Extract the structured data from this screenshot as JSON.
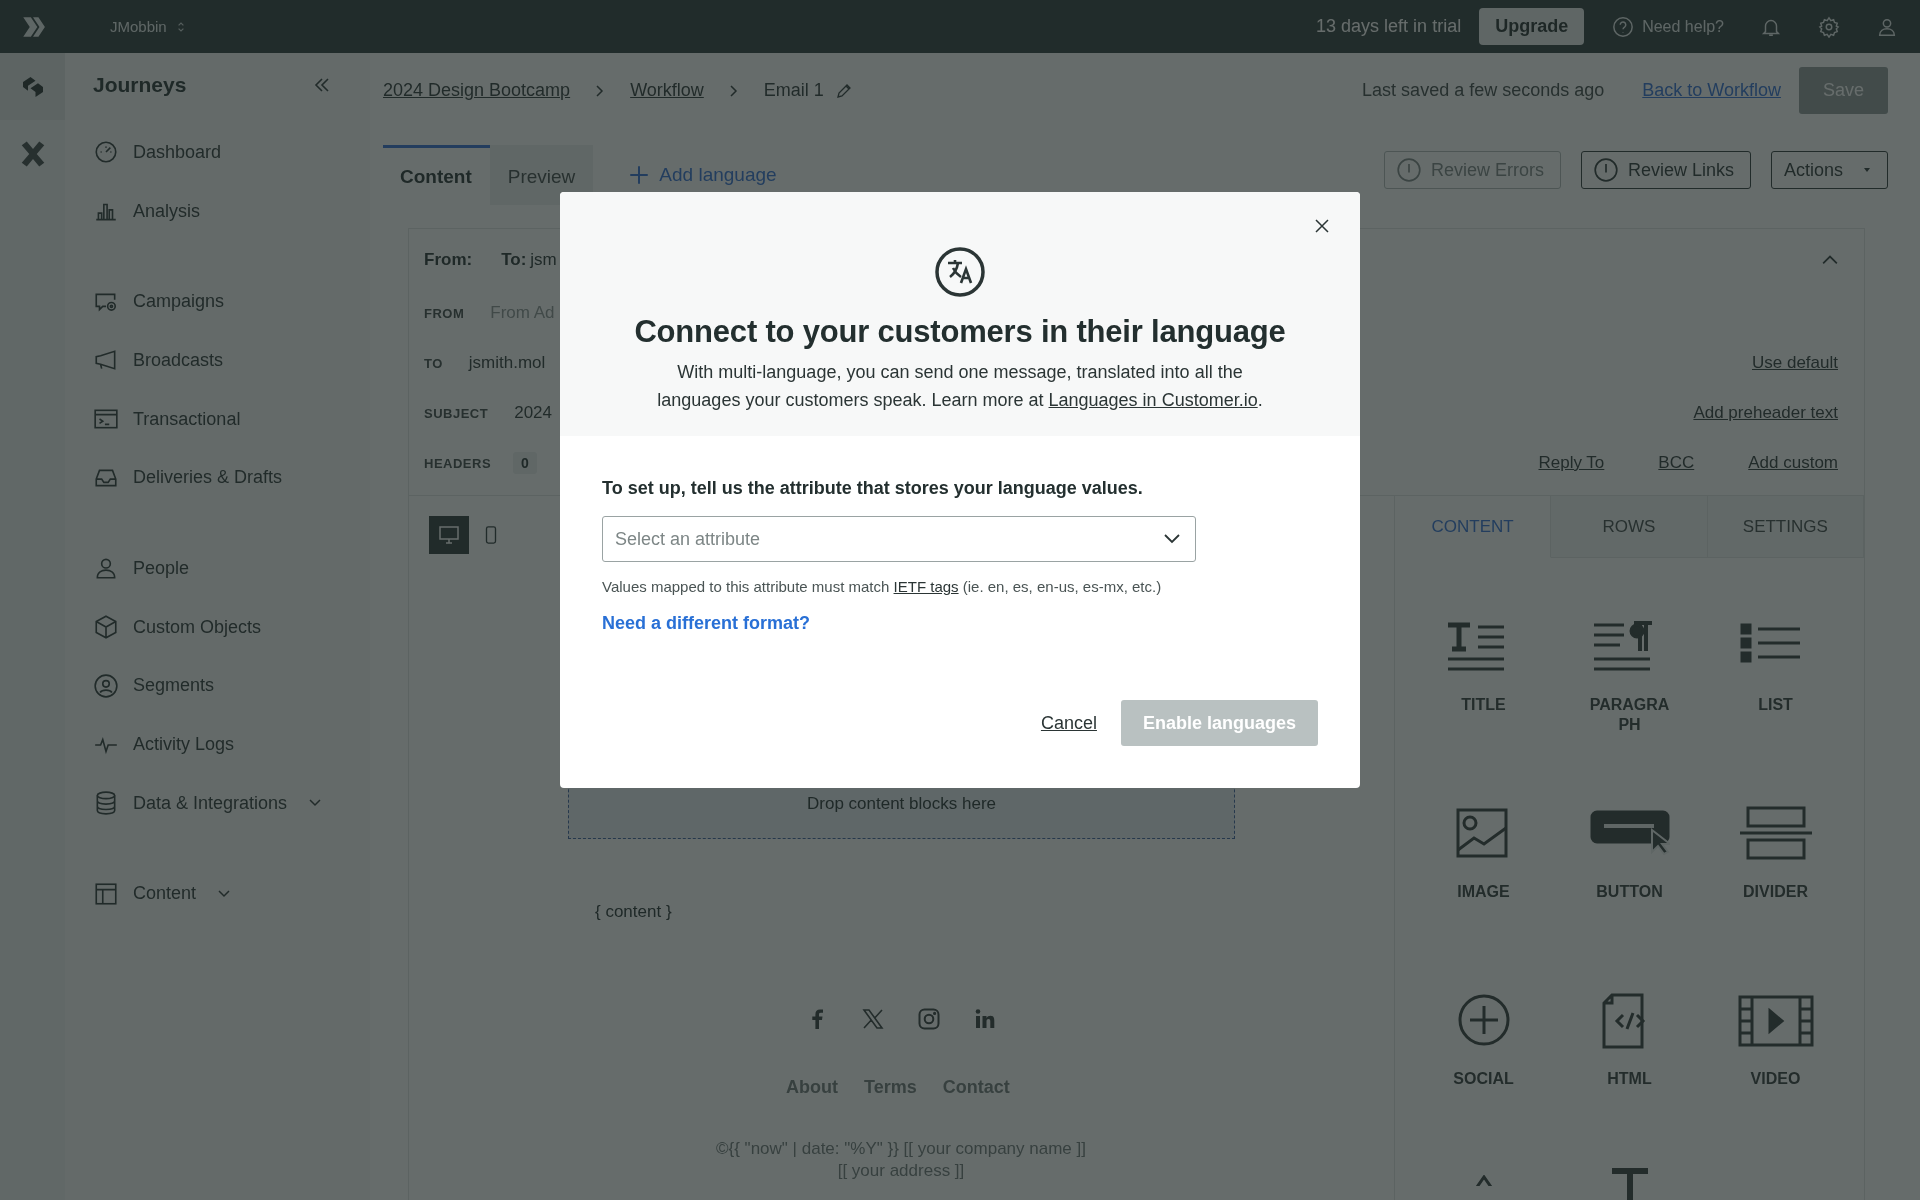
{
  "top_bar": {
    "workspace": "JMobbin",
    "trial": "13 days left in trial",
    "upgrade": "Upgrade",
    "help": "Need help?"
  },
  "sidebar": {
    "title": "Journeys",
    "groups": [
      [
        {
          "label": "Dashboard",
          "kind": "link"
        },
        {
          "label": "Analysis",
          "kind": "link"
        }
      ],
      [
        {
          "label": "Campaigns",
          "kind": "link"
        },
        {
          "label": "Broadcasts",
          "kind": "link"
        },
        {
          "label": "Transactional",
          "kind": "link"
        },
        {
          "label": "Deliveries & Drafts",
          "kind": "link"
        }
      ],
      [
        {
          "label": "People",
          "kind": "link"
        },
        {
          "label": "Custom Objects",
          "kind": "link"
        },
        {
          "label": "Segments",
          "kind": "link"
        },
        {
          "label": "Activity Logs",
          "kind": "link"
        },
        {
          "label": "Data & Integrations",
          "kind": "group"
        }
      ],
      [
        {
          "label": "Content",
          "kind": "group"
        }
      ]
    ]
  },
  "breadcrumbs": [
    {
      "label": "2024 Design Bootcamp",
      "kind": "link"
    },
    {
      "label": "Workflow",
      "kind": "link"
    },
    {
      "label": "Email 1",
      "kind": "current"
    }
  ],
  "saved": "Last saved a few seconds ago",
  "back_link": "Back to Workflow",
  "save": {
    "label": "Save",
    "disabled": true
  },
  "tabs": [
    {
      "label": "Content",
      "selected": true
    },
    {
      "label": "Preview",
      "selected": false
    }
  ],
  "add_language": "Add language",
  "actions": [
    {
      "label": "Review Errors",
      "kind": "review",
      "disabled": true
    },
    {
      "label": "Review Links",
      "kind": "review",
      "disabled": false
    },
    {
      "label": "Actions",
      "kind": "menu",
      "disabled": false
    }
  ],
  "email_header": {
    "from_label": "From:",
    "to_label": "To:",
    "to_value": "jsm",
    "fields": [
      {
        "label": "FROM",
        "placeholder": "From Ad"
      },
      {
        "label": "TO",
        "value": "jsmith.mol",
        "link": "Use default"
      },
      {
        "label": "SUBJECT",
        "value": "2024",
        "link": "Add preheader text"
      },
      {
        "label": "HEADERS",
        "count": "0"
      }
    ],
    "links": [
      "Reply To",
      "BCC",
      "Add custom"
    ]
  },
  "view_toggle": [
    {
      "kind": "desktop",
      "selected": true
    },
    {
      "kind": "mobile",
      "selected": false
    }
  ],
  "canvas": {
    "drop_zone": "Drop content blocks here",
    "content": "{ content }",
    "footer_links": [
      "About",
      "Terms",
      "Contact"
    ],
    "footer_lines": [
      "©{{ \"now\" | date: \"%Y\" }} [[ your company name ]]",
      "[[ your address ]]"
    ]
  },
  "panel": {
    "tabs": [
      {
        "label": "CONTENT",
        "selected": true
      },
      {
        "label": "ROWS",
        "selected": false
      },
      {
        "label": "SETTINGS",
        "selected": false
      }
    ],
    "blocks": [
      {
        "label": "TITLE"
      },
      {
        "label": "PARAGRAPH"
      },
      {
        "label": "LIST"
      },
      {
        "label": "IMAGE"
      },
      {
        "label": "BUTTON"
      },
      {
        "label": "DIVIDER"
      },
      {
        "label": "SOCIAL"
      },
      {
        "label": "HTML"
      },
      {
        "label": "VIDEO"
      }
    ]
  },
  "modal": {
    "title": "Connect to your customers in their language",
    "intro": "With multi-language, you can send one message, translated into all the languages your customers speak. Learn more at",
    "intro_link": "Languages in Customer.io",
    "intro_end": ".",
    "field_label": "To set up, tell us the attribute that stores your language values.",
    "select": {
      "placeholder": "Select an attribute"
    },
    "hint": "Values mapped to this attribute must match",
    "hint_link": "IETF tags",
    "hint_end": "(ie. en, es, en-us, es-mx, etc.)",
    "format_link": "Need a different format?",
    "cancel": "Cancel",
    "confirm": {
      "label": "Enable languages",
      "disabled": true
    }
  }
}
